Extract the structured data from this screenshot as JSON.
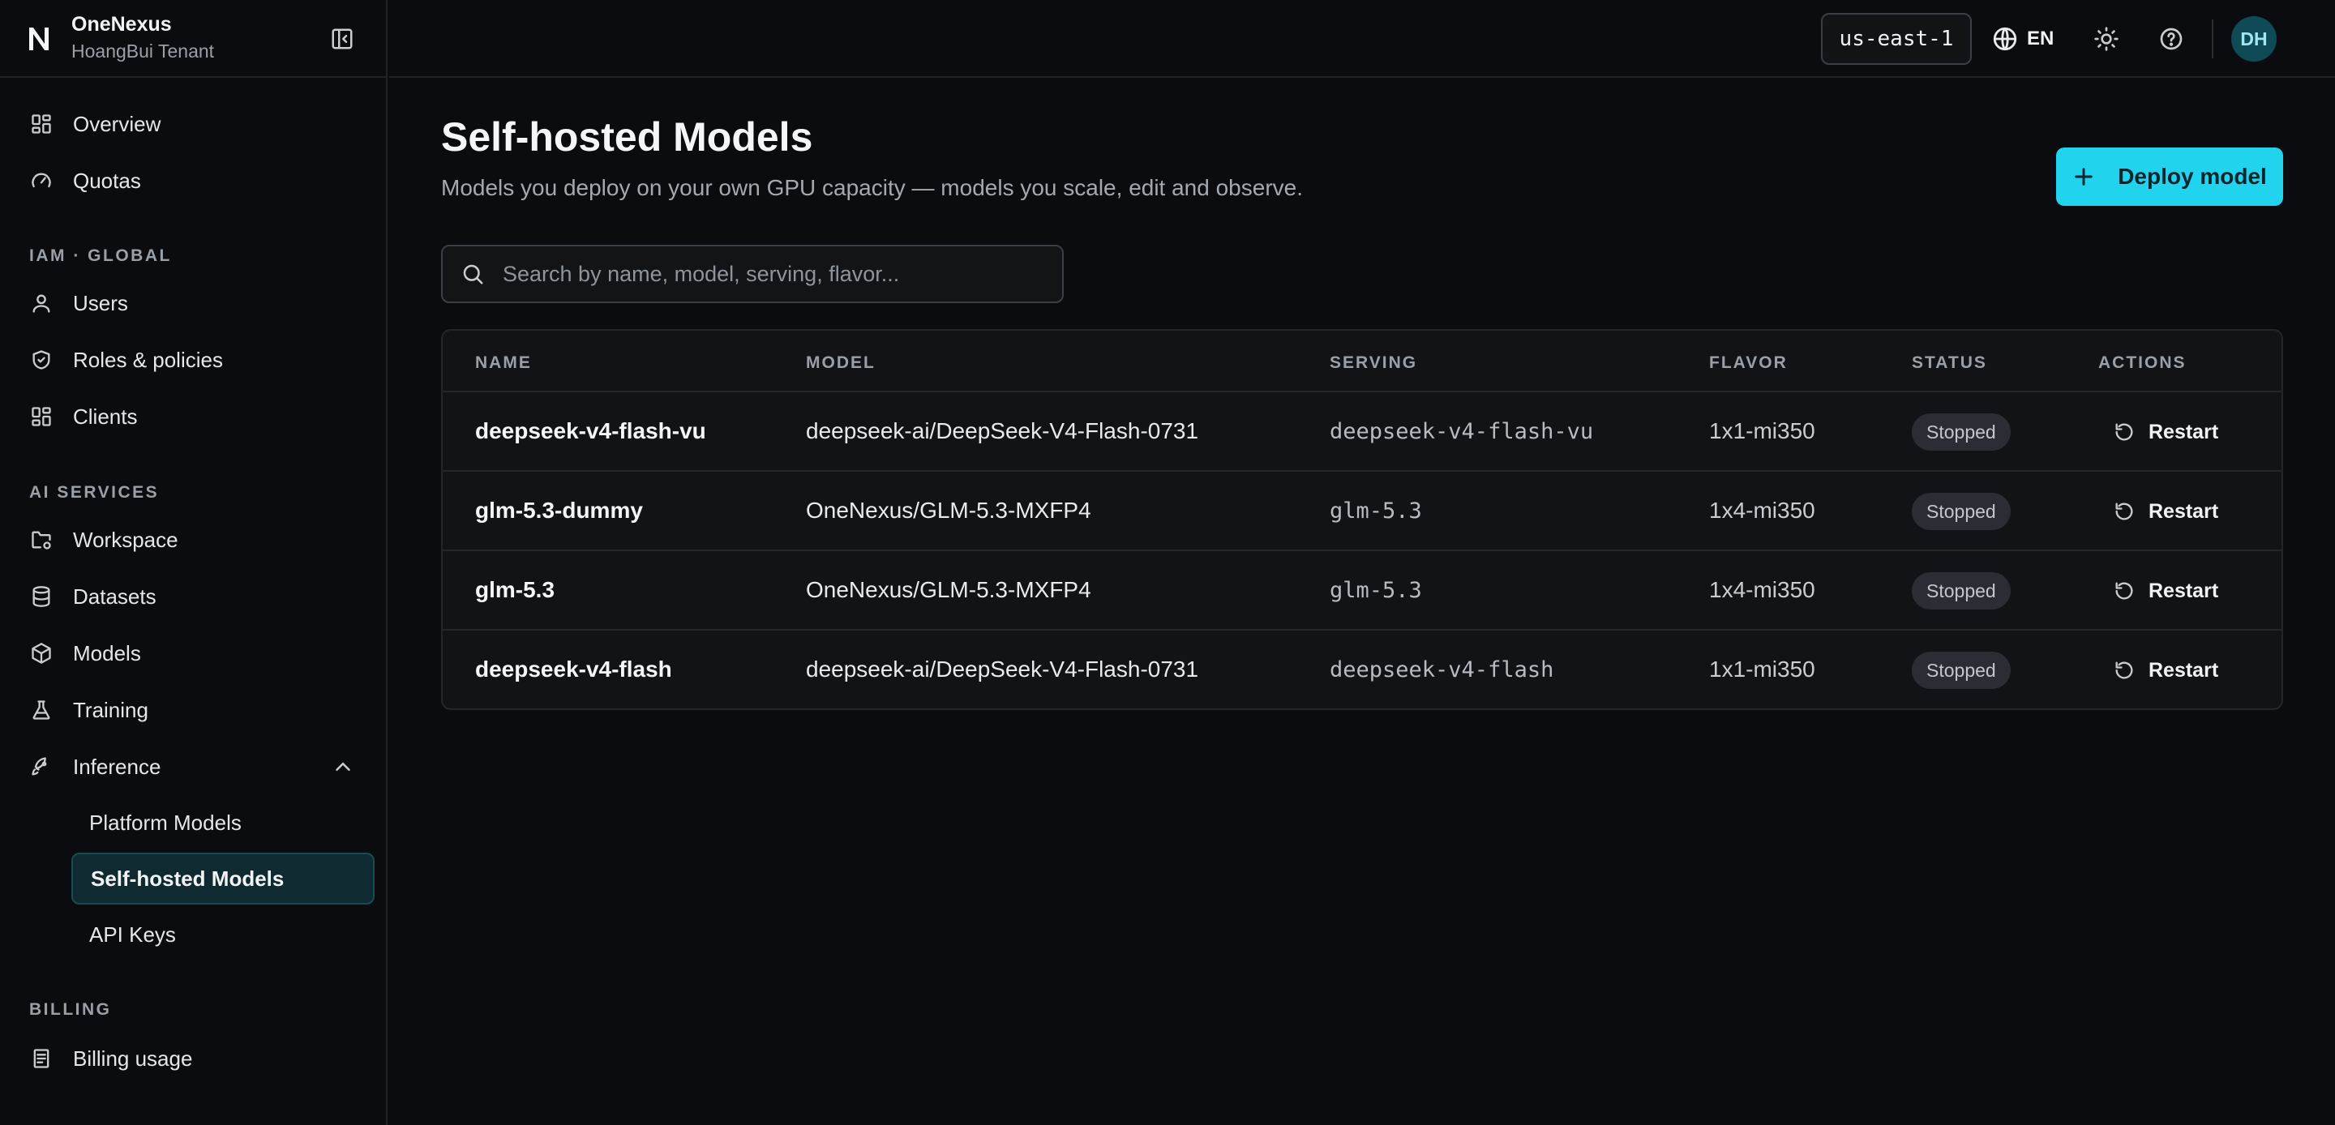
{
  "brand": {
    "logo": "N",
    "name": "OneNexus",
    "tenant": "HoangBui Tenant"
  },
  "sidebar": {
    "top_items": [
      {
        "label": "Overview",
        "icon": "grid-icon"
      },
      {
        "label": "Quotas",
        "icon": "gauge-icon"
      }
    ],
    "iam_section": "IAM · GLOBAL",
    "iam_items": [
      {
        "label": "Users",
        "icon": "user-icon"
      },
      {
        "label": "Roles & policies",
        "icon": "shield-icon"
      },
      {
        "label": "Clients",
        "icon": "grid-icon"
      }
    ],
    "ai_section": "AI SERVICES",
    "ai_items": [
      {
        "label": "Workspace",
        "icon": "folder-gear-icon"
      },
      {
        "label": "Datasets",
        "icon": "database-icon"
      },
      {
        "label": "Models",
        "icon": "cube-icon"
      },
      {
        "label": "Training",
        "icon": "flask-icon"
      },
      {
        "label": "Inference",
        "icon": "rocket-icon"
      }
    ],
    "inference_sub": [
      {
        "label": "Platform Models"
      },
      {
        "label": "Self-hosted Models"
      },
      {
        "label": "API Keys"
      }
    ],
    "billing_section": "BILLING",
    "billing_items": [
      {
        "label": "Billing usage",
        "icon": "receipt-icon"
      }
    ]
  },
  "topbar": {
    "region": "us-east-1",
    "language": "EN",
    "avatar_initials": "DH"
  },
  "page": {
    "title": "Self-hosted Models",
    "subtitle": "Models you deploy on your own GPU capacity — models you scale, edit and observe.",
    "deploy_label": "Deploy model",
    "search_placeholder": "Search by name, model, serving, flavor..."
  },
  "table": {
    "headers": {
      "name": "NAME",
      "model": "MODEL",
      "serving": "SERVING",
      "flavor": "FLAVOR",
      "status": "STATUS",
      "actions": "ACTIONS"
    },
    "rows": [
      {
        "name": "deepseek-v4-flash-vu",
        "model": "deepseek-ai/DeepSeek-V4-Flash-0731",
        "serving": "deepseek-v4-flash-vu",
        "flavor": "1x1-mi350",
        "status": "Stopped",
        "action": "Restart"
      },
      {
        "name": "glm-5.3-dummy",
        "model": "OneNexus/GLM-5.3-MXFP4",
        "serving": "glm-5.3",
        "flavor": "1x4-mi350",
        "status": "Stopped",
        "action": "Restart"
      },
      {
        "name": "glm-5.3",
        "model": "OneNexus/GLM-5.3-MXFP4",
        "serving": "glm-5.3",
        "flavor": "1x4-mi350",
        "status": "Stopped",
        "action": "Restart"
      },
      {
        "name": "deepseek-v4-flash",
        "model": "deepseek-ai/DeepSeek-V4-Flash-0731",
        "serving": "deepseek-v4-flash",
        "flavor": "1x1-mi350",
        "status": "Stopped",
        "action": "Restart"
      }
    ]
  },
  "colors": {
    "accent": "#22d3ee",
    "background": "#0b0c0f",
    "active_nav": "#0f2b31",
    "avatar": "#0f4b57"
  }
}
